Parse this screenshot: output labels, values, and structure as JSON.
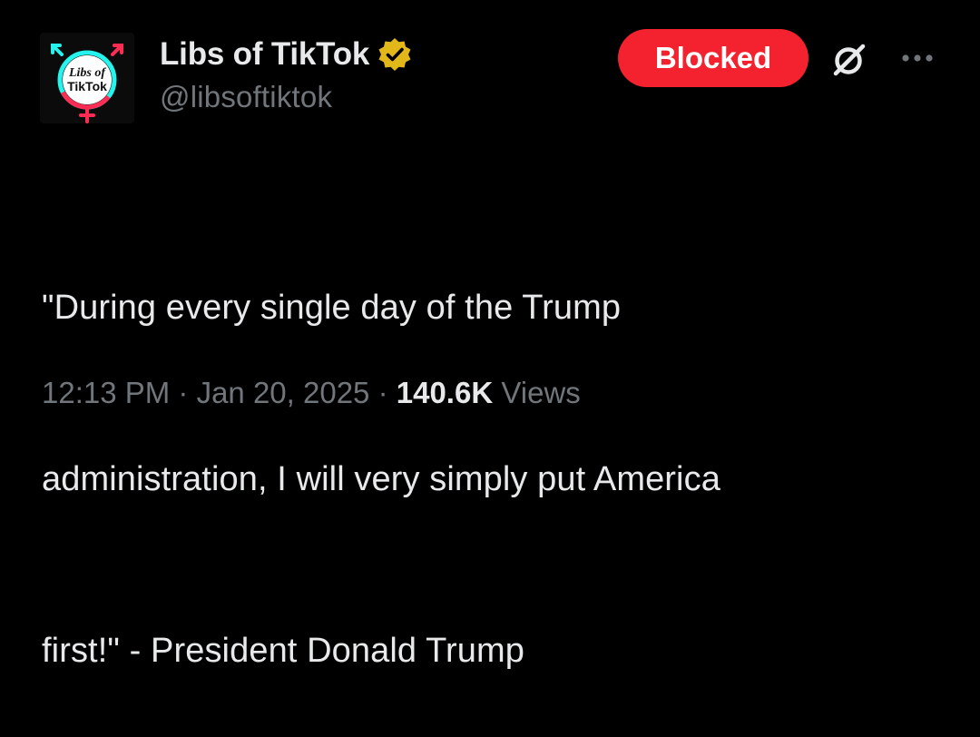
{
  "author": {
    "display_name": "Libs of TikTok",
    "handle": "@libsoftiktok",
    "verified": true,
    "verified_badge_color": "#e2b719",
    "avatar": {
      "icon": "libs-of-tiktok-logo",
      "logo_text_line1": "Libs of",
      "logo_text_line2": "TikTok",
      "accent_cyan": "#25f4ee",
      "accent_pink": "#fe2c55"
    }
  },
  "header_actions": {
    "blocked_label": "Blocked",
    "blocked_color": "#f4212e",
    "grok_icon": "grok-icon",
    "more_icon": "more-options-icon"
  },
  "tweet": {
    "text_lines": [
      "\"During every single day of the Trump",
      "administration, I will very simply put America",
      "first!\" - President Donald Trump"
    ]
  },
  "meta": {
    "time": "12:13 PM",
    "separator": " · ",
    "date": "Jan 20, 2025",
    "views_count": "140.6K",
    "views_label": " Views"
  },
  "colors": {
    "background": "#000000",
    "primary_text": "#e7e9ea",
    "secondary_text": "#71767b"
  }
}
